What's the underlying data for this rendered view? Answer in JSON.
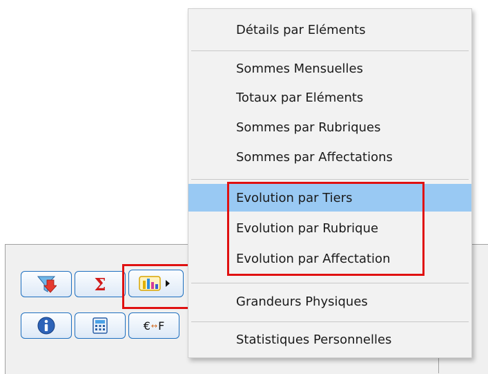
{
  "toolbar": {
    "buttons": [
      {
        "name": "filter",
        "icon": "filter-down-arrow-icon"
      },
      {
        "name": "sum",
        "icon": "sigma-icon",
        "symbol": "Σ"
      },
      {
        "name": "chart-menu",
        "icon": "bar-chart-submenu-icon"
      },
      {
        "name": "info",
        "icon": "info-icon"
      },
      {
        "name": "calculator",
        "icon": "calculator-icon"
      },
      {
        "name": "currency",
        "icon": "euro-franc-convert-icon",
        "label_left": "€",
        "label_arrows": "↔",
        "label_right": "F"
      }
    ]
  },
  "menu": {
    "items": [
      "Détails par Eléments",
      "Sommes Mensuelles",
      "Totaux par Eléments",
      "Sommes par Rubriques",
      "Sommes par Affectations",
      "Evolution par Tiers",
      "Evolution par Rubrique",
      "Evolution par Affectation",
      "Grandeurs Physiques",
      "Statistiques Personnelles"
    ],
    "selected_index": 5
  },
  "colors": {
    "highlight": "#e01010",
    "selection": "#99c9f3",
    "button_border": "#1c6ebf"
  }
}
